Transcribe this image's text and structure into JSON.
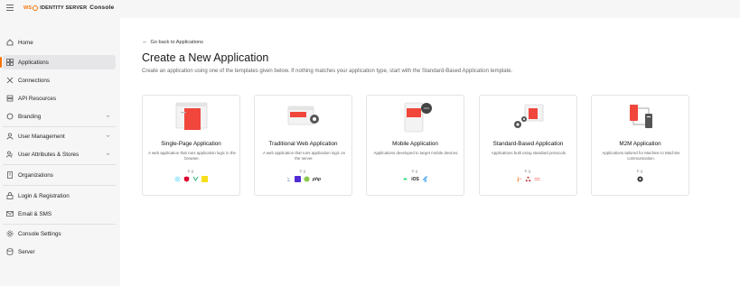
{
  "header": {
    "brand": "WS",
    "product": "IDENTITY SERVER",
    "console": "Console"
  },
  "sidebar": {
    "items": [
      {
        "label": "Home",
        "icon": "home-icon"
      },
      {
        "label": "Applications",
        "icon": "applications-icon",
        "active": true
      },
      {
        "label": "Connections",
        "icon": "connections-icon"
      },
      {
        "label": "API Resources",
        "icon": "api-resources-icon"
      },
      {
        "label": "Branding",
        "icon": "branding-icon",
        "expandable": true
      },
      {
        "label": "User Management",
        "icon": "user-management-icon",
        "expandable": true
      },
      {
        "label": "User Attributes & Stores",
        "icon": "user-attributes-icon",
        "expandable": true
      },
      {
        "label": "Organizations",
        "icon": "organizations-icon"
      },
      {
        "label": "Login & Registration",
        "icon": "login-registration-icon"
      },
      {
        "label": "Email & SMS",
        "icon": "email-sms-icon"
      },
      {
        "label": "Console Settings",
        "icon": "console-settings-icon"
      },
      {
        "label": "Server",
        "icon": "server-icon"
      }
    ]
  },
  "main": {
    "back_link": "Go back to Applications",
    "title": "Create a New Application",
    "subtitle": "Create an application using one of the templates given below. If nothing matches your application type, start with the Standard-Based Application template.",
    "eg_label": "E.g.",
    "cards": [
      {
        "title": "Single-Page Application",
        "description": "A web application that runs application logic in the browser.",
        "techs": [
          "react-icon",
          "angular-icon",
          "vue-icon",
          "javascript-icon"
        ]
      },
      {
        "title": "Traditional Web Application",
        "description": "A web application that runs application logic on the server.",
        "techs": [
          "java-icon",
          "dotnet-icon",
          "nodejs-icon",
          "php-icon"
        ]
      },
      {
        "title": "Mobile Application",
        "description": "Applications developed to target mobile devices.",
        "techs": [
          "android-icon",
          "ios-icon",
          "flutter-icon"
        ]
      },
      {
        "title": "Standard-Based Application",
        "description": "Applications built using standard protocols.",
        "techs": [
          "oidc-icon",
          "saml-icon",
          "wsfed-icon"
        ]
      },
      {
        "title": "M2M Application",
        "description": "Applications tailored for Machine to Machine communication.",
        "techs": [
          "m2m-icon"
        ]
      }
    ]
  },
  "colors": {
    "accent": "#ff7300",
    "card_red": "#f0463c",
    "sidebar_bg": "#f6f6f7",
    "active_bg": "#e6e6e9"
  }
}
